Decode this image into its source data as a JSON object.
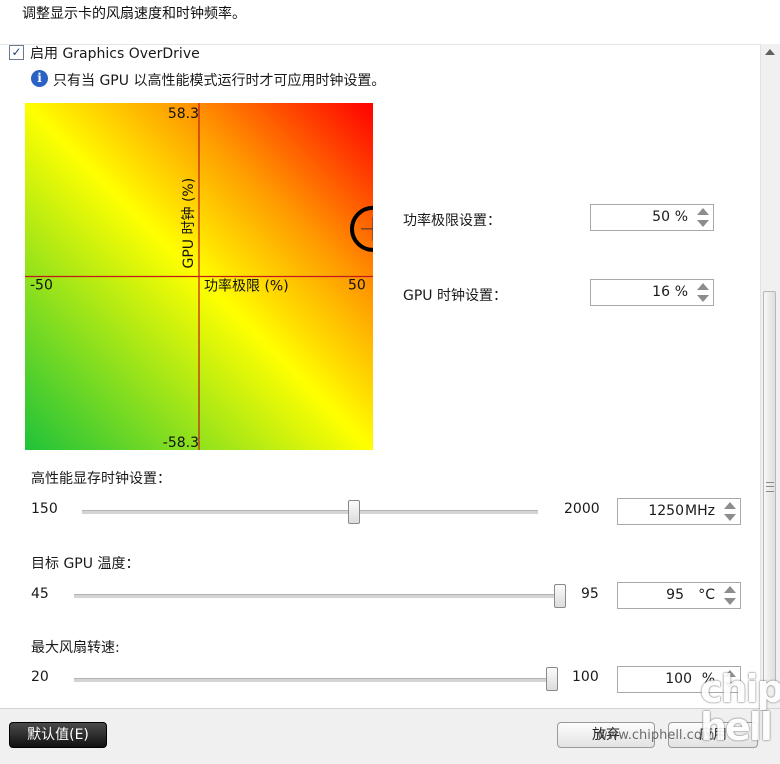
{
  "header": {
    "description": "调整显示卡的风扇速度和时钟频率。"
  },
  "overdrive": {
    "enable_label": "启用 Graphics OverDrive",
    "enabled": true,
    "checkmark": "✓",
    "info_icon_glyph": "i",
    "info_text": "只有当 GPU 以高性能模式运行时才可应用时钟设置。"
  },
  "chart_data": {
    "type": "heatmap",
    "x_axis_label": "功率极限 (%)",
    "y_axis_label": "GPU 时钟 (%)",
    "x_range": [
      -50,
      50
    ],
    "y_range": [
      -58.3,
      58.3
    ],
    "x_tick_labels": [
      "-50",
      "50"
    ],
    "y_tick_labels": [
      "58.3",
      "-58.3"
    ],
    "current_point": {
      "x": 50,
      "y": 16
    },
    "gradient_colors": [
      "#1fc23a",
      "#ffff00",
      "#ff9a00",
      "#ff0000"
    ],
    "axis_color": "#c21a1a"
  },
  "power_limit": {
    "label": "功率极限设置：",
    "value": "50",
    "unit": "%"
  },
  "gpu_clock": {
    "label": "GPU 时钟设置：",
    "value": "16",
    "unit": "%"
  },
  "memory_clock": {
    "label": "高性能显存时钟设置：",
    "min": "150",
    "max": "2000",
    "value": "1250",
    "unit": "MHz",
    "level": 0.6
  },
  "target_temp": {
    "label": "目标 GPU 温度：",
    "min": "45",
    "max": "95",
    "value": "95",
    "unit": "°C",
    "level": 1.0
  },
  "max_fan": {
    "label": "最大风扇转速:",
    "min": "20",
    "max": "100",
    "value": "100",
    "unit": "%",
    "level": 1.0
  },
  "buttons": {
    "default_label": "默认值(E)",
    "discard_label": "放弃",
    "apply_label": "应用"
  },
  "watermark": {
    "url": "www.chiphell.com",
    "logo": "chip hell"
  }
}
